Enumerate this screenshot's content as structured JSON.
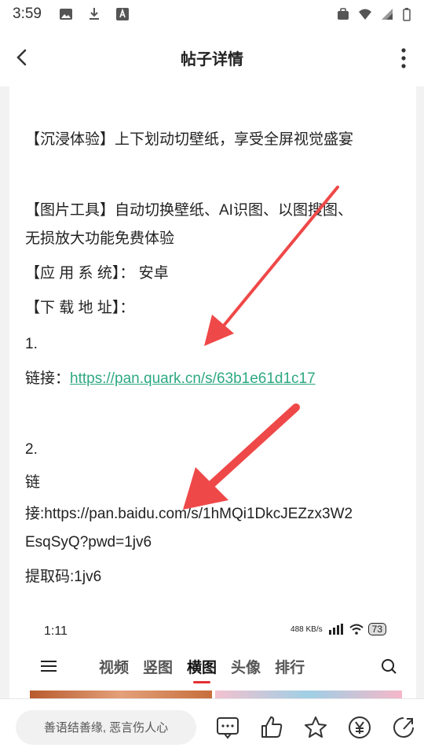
{
  "status_bar": {
    "time": "3:59"
  },
  "header": {
    "title": "帖子详情"
  },
  "post": {
    "line1": "【沉浸体验】上下划动切壁纸，享受全屏视觉盛宴",
    "line2": "【图片工具】自动切换壁纸、AI识图、以图搜图、",
    "line3": "无损放大功能免费体验",
    "line4": "【应 用 系 统】：  安卓",
    "line5": "【下 载 地 址】：",
    "item1_num": "1.",
    "item1_prefix": "链接：",
    "item1_link": "https://pan.quark.cn/s/63b1e61d1c17",
    "item2_num": "2.",
    "item2_line1": "链",
    "item2_line2": "接:https://pan.baidu.com/s/1hMQi1DkcJEZzx3W2",
    "item2_line3": "EsqSyQ?pwd=1jv6",
    "item2_code": "提取码:1jv6"
  },
  "embed": {
    "time": "1:11",
    "speed": "488 KB/s",
    "battery": "73",
    "tabs": [
      "视频",
      "竖图",
      "横图",
      "头像",
      "排行"
    ],
    "active_tab": "横图"
  },
  "bottom": {
    "comment_placeholder": "善语结善缘, 恶言伤人心"
  },
  "colors": {
    "link": "#2ea882",
    "accent": "#e53030",
    "arrow": "#ef4848"
  }
}
